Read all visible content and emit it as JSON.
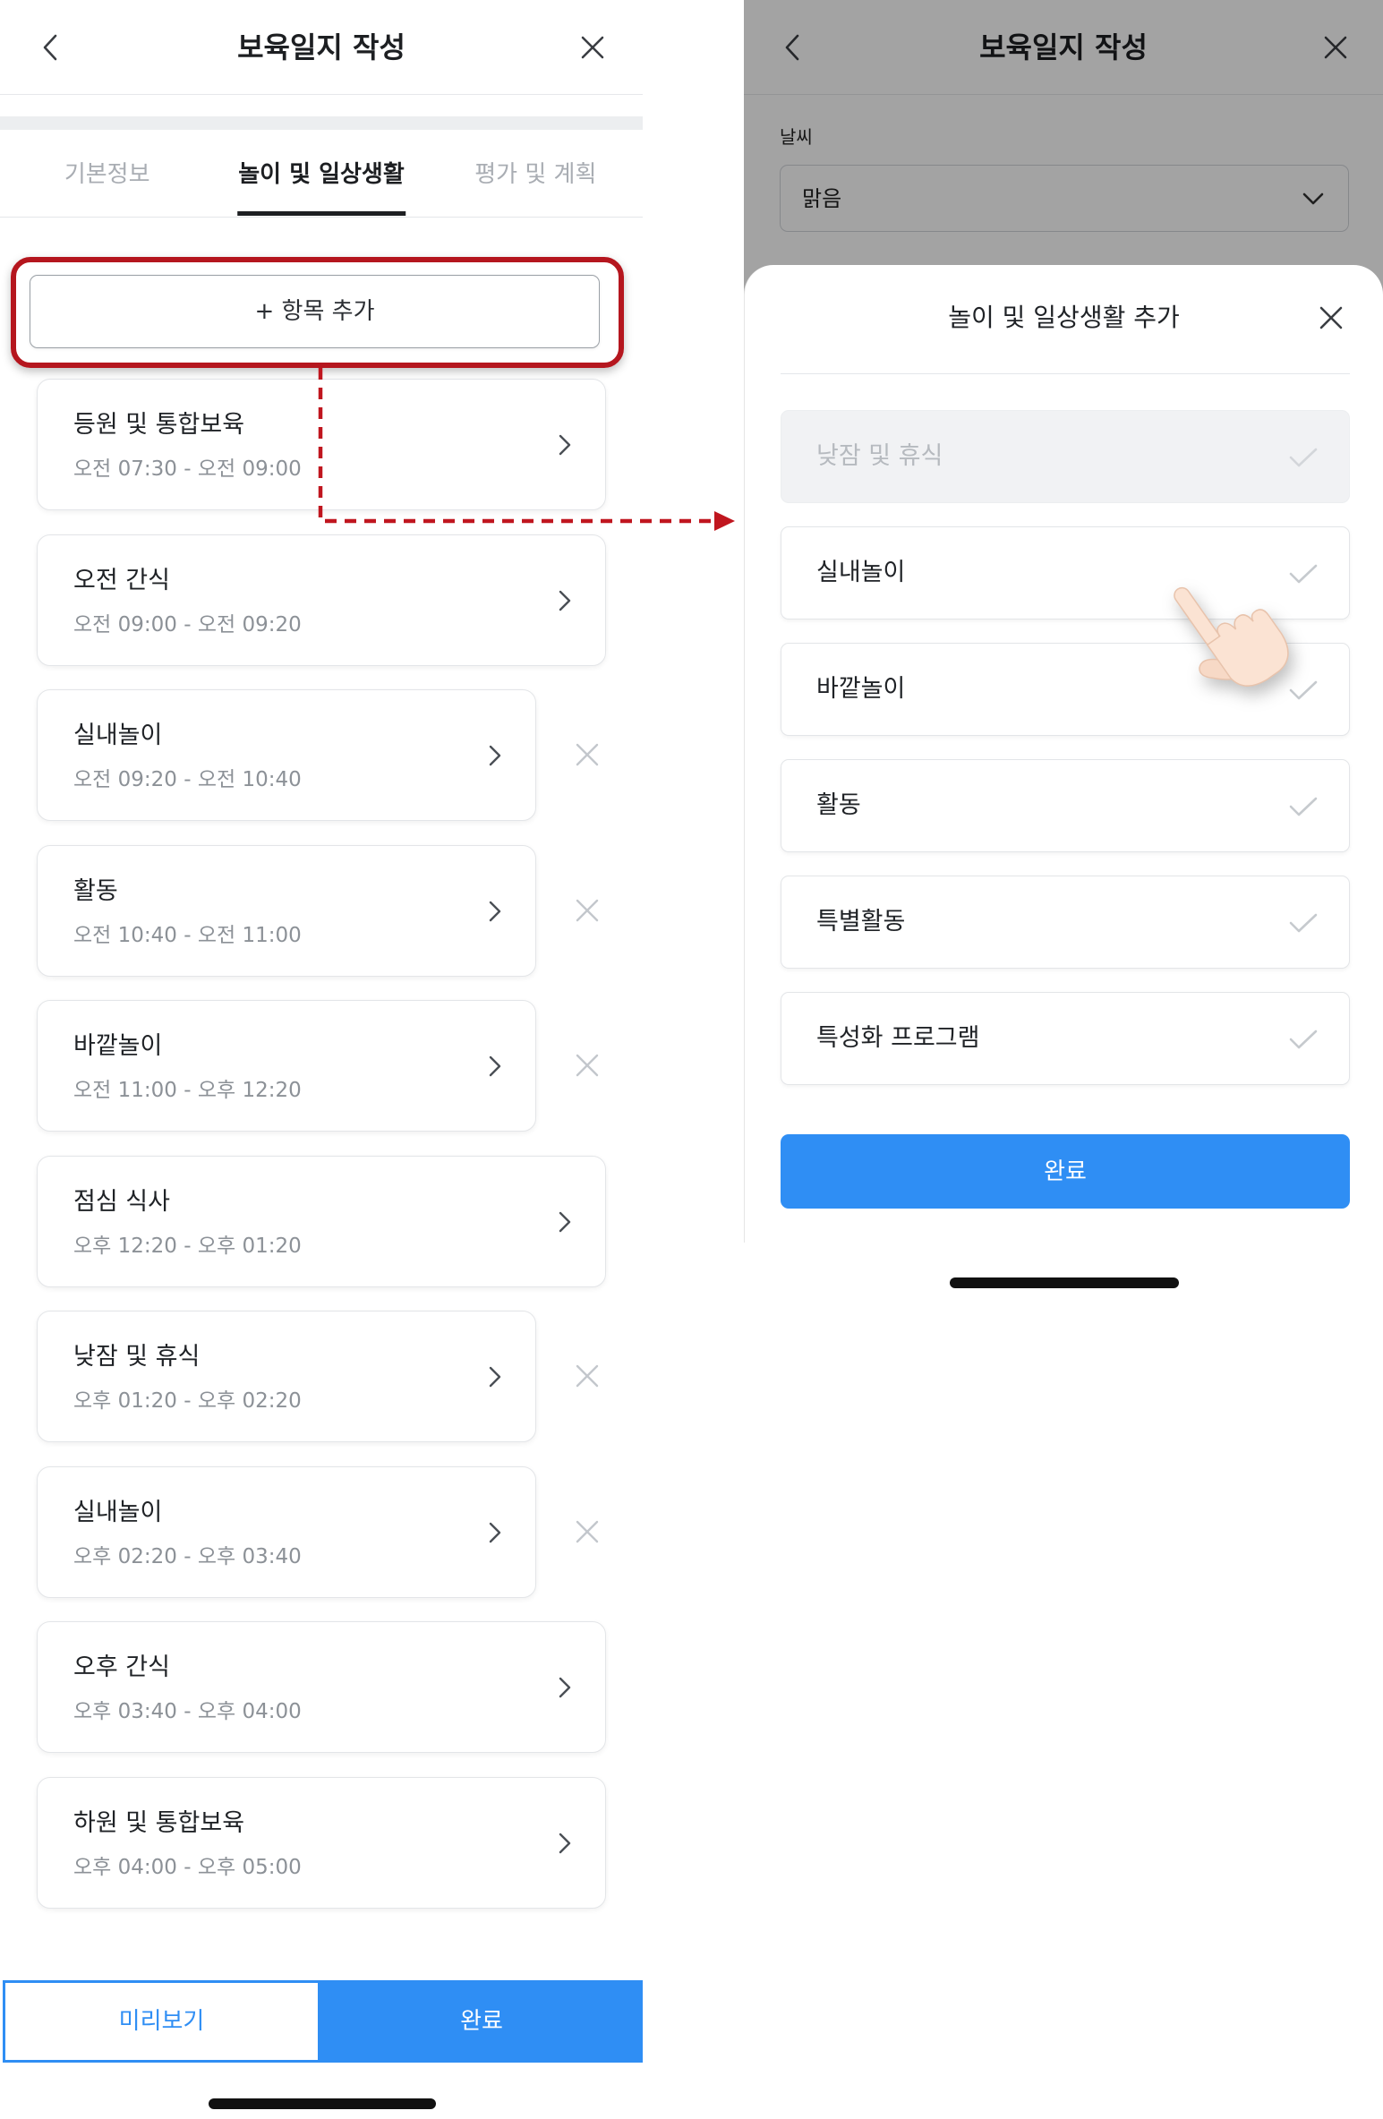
{
  "colors": {
    "primary_blue": "#2f8ef4",
    "highlight_red": "#b5161e",
    "text_primary": "#1f2226",
    "text_secondary": "#8c9197",
    "text_inactive": "#a9adb3",
    "border": "#e3e5e8",
    "dim_overlay": "rgba(0,0,0,0.36)"
  },
  "icons": {
    "back": "chevron-left-icon",
    "close": "close-icon",
    "item_open": "chevron-right-icon",
    "item_delete": "close-icon",
    "select_arrow": "chevron-down-icon",
    "option_check": "check-icon",
    "pointer": "hand-pointer-icon"
  },
  "left_screen": {
    "header": {
      "title": "보육일지 작성"
    },
    "tabs": [
      {
        "label": "기본정보",
        "active": false
      },
      {
        "label": "놀이 및 일상생활",
        "active": true
      },
      {
        "label": "평가 및 계획",
        "active": false
      }
    ],
    "add_item_label": "+ 항목 추가",
    "schedule": [
      {
        "title": "등원 및 통합보육",
        "time": "오전 07:30 - 오전 09:00",
        "deletable": false
      },
      {
        "title": "오전 간식",
        "time": "오전 09:00 - 오전 09:20",
        "deletable": false
      },
      {
        "title": "실내놀이",
        "time": "오전 09:20 - 오전 10:40",
        "deletable": true
      },
      {
        "title": "활동",
        "time": "오전 10:40 - 오전 11:00",
        "deletable": true
      },
      {
        "title": "바깥놀이",
        "time": "오전 11:00 - 오후 12:20",
        "deletable": true
      },
      {
        "title": "점심 식사",
        "time": "오후 12:20 - 오후 01:20",
        "deletable": false
      },
      {
        "title": "낮잠 및 휴식",
        "time": "오후 01:20 - 오후 02:20",
        "deletable": true
      },
      {
        "title": "실내놀이",
        "time": "오후 02:20 - 오후 03:40",
        "deletable": true
      },
      {
        "title": "오후 간식",
        "time": "오후 03:40 - 오후 04:00",
        "deletable": false
      },
      {
        "title": "하원 및 통합보육",
        "time": "오후 04:00 - 오후 05:00",
        "deletable": false
      }
    ],
    "footer": {
      "preview_label": "미리보기",
      "done_label": "완료"
    }
  },
  "right_screen": {
    "header": {
      "title": "보육일지 작성"
    },
    "weather": {
      "label": "날씨",
      "value": "맑음"
    },
    "sheet": {
      "title": "놀이 및 일상생활 추가",
      "options": [
        {
          "label": "낮잠 및 휴식",
          "disabled": true
        },
        {
          "label": "실내놀이",
          "disabled": false
        },
        {
          "label": "바깥놀이",
          "disabled": false
        },
        {
          "label": "활동",
          "disabled": false
        },
        {
          "label": "특별활동",
          "disabled": false
        },
        {
          "label": "특성화 프로그램",
          "disabled": false
        }
      ],
      "done_label": "완료"
    }
  }
}
